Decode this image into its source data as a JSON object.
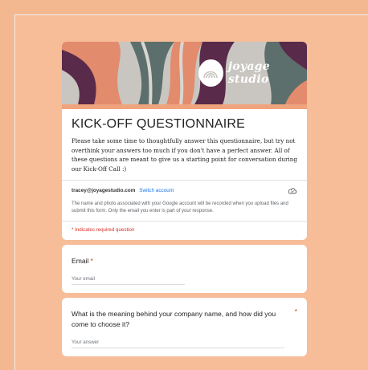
{
  "colors": {
    "page_background": "#f4b891",
    "title_accent": "#f0a47e",
    "required_red": "#d93025",
    "link_blue": "#1a73e8"
  },
  "banner": {
    "brand_name": "joyage studio",
    "logo_icon": "joyage-logo-icon"
  },
  "form": {
    "title": "KICK-OFF QUESTIONNAIRE",
    "description": "Please take some time to thoughtfully answer this questionnaire, but try not overthink your answers too much if you don't have a perfect answer. All of these questions are meant to give us a starting point for conversation during our Kick-Off Call :)",
    "account_email": "tracey@joyagestudio.com",
    "switch_account": "Switch account",
    "account_notice": "The name and photo associated with your Google account will be recorded when you upload files and submit this form. Only the email you enter is part of your response.",
    "required_note": "* Indicates required question"
  },
  "questions": [
    {
      "label": "Email",
      "required_marker": "*",
      "placeholder": "Your email"
    },
    {
      "label": "What is the meaning behind your company name, and how did you come to choose it?",
      "required_marker": "*",
      "placeholder": "Your answer"
    }
  ]
}
